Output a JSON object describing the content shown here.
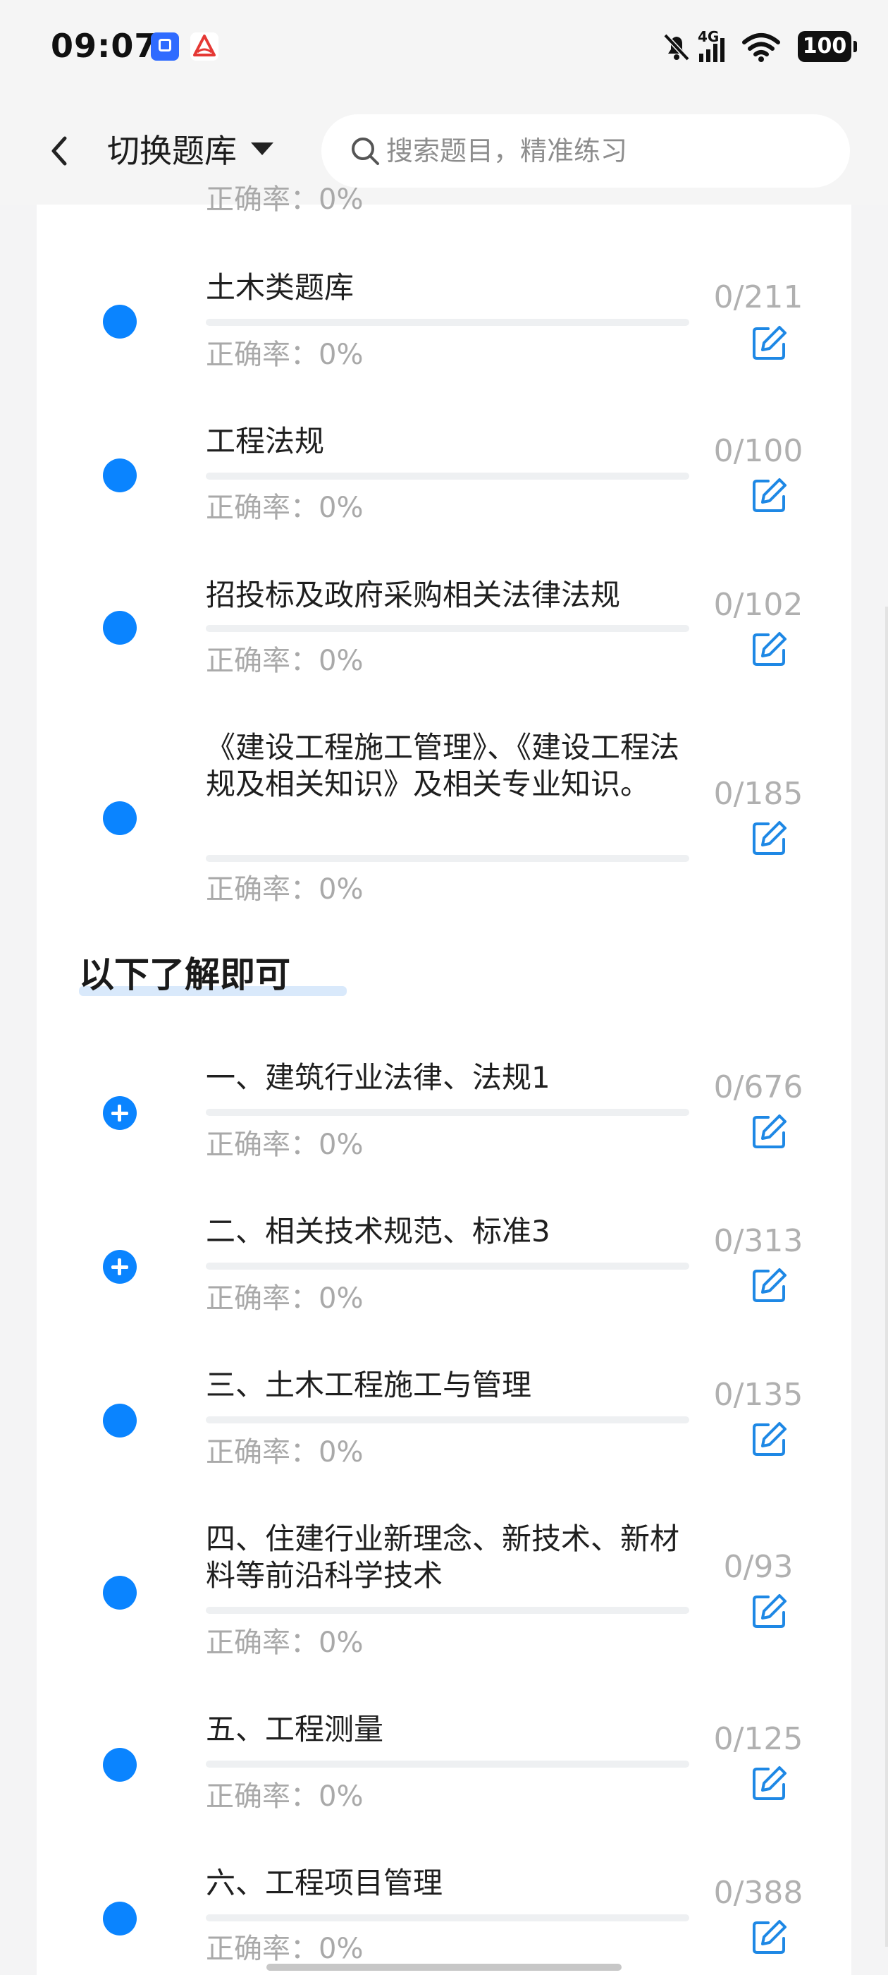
{
  "status": {
    "time": "09:07",
    "network": "4G",
    "battery": "100"
  },
  "header": {
    "bank_switch_label": "切换题库",
    "search_placeholder": "搜索题目，精准练习"
  },
  "partial_top": {
    "accuracy": "正确率：0%"
  },
  "section_heading": "以下了解即可",
  "rows": [
    {
      "title": "土木类题库",
      "accuracy": "正确率：0%",
      "count": "0/211",
      "icon": "dot"
    },
    {
      "title": "工程法规",
      "accuracy": "正确率：0%",
      "count": "0/100",
      "icon": "dot"
    },
    {
      "title": "招投标及政府采购相关法律法规",
      "accuracy": "正确率：0%",
      "count": "0/102",
      "icon": "dot"
    },
    {
      "title": "《建设工程施工管理》、《建设工程法规及相关知识》及相关专业知识。",
      "accuracy": "正确率：0%",
      "count": "0/185",
      "icon": "dot"
    },
    {
      "title": "一、建筑行业法律、法规1",
      "accuracy": "正确率：0%",
      "count": "0/676",
      "icon": "plus"
    },
    {
      "title": "二、相关技术规范、标准3",
      "accuracy": "正确率：0%",
      "count": "0/313",
      "icon": "plus"
    },
    {
      "title": "三、土木工程施工与管理",
      "accuracy": "正确率：0%",
      "count": "0/135",
      "icon": "dot"
    },
    {
      "title": "四、住建行业新理念、新技术、新材料等前沿科学技术",
      "accuracy": "正确率：0%",
      "count": "0/93",
      "icon": "dot"
    },
    {
      "title": "五、工程测量",
      "accuracy": "正确率：0%",
      "count": "0/125",
      "icon": "dot"
    },
    {
      "title": "六、工程项目管理",
      "accuracy": "正确率：0%",
      "count": "0/388",
      "icon": "dot"
    }
  ],
  "colors": {
    "accent": "#0a84ff",
    "muted": "#a9a9a9",
    "background": "#f4f4f5"
  },
  "icons": {
    "back": "chevron-left-icon",
    "search": "search-icon",
    "edit": "edit-icon",
    "expand": "plus-circle-icon"
  }
}
